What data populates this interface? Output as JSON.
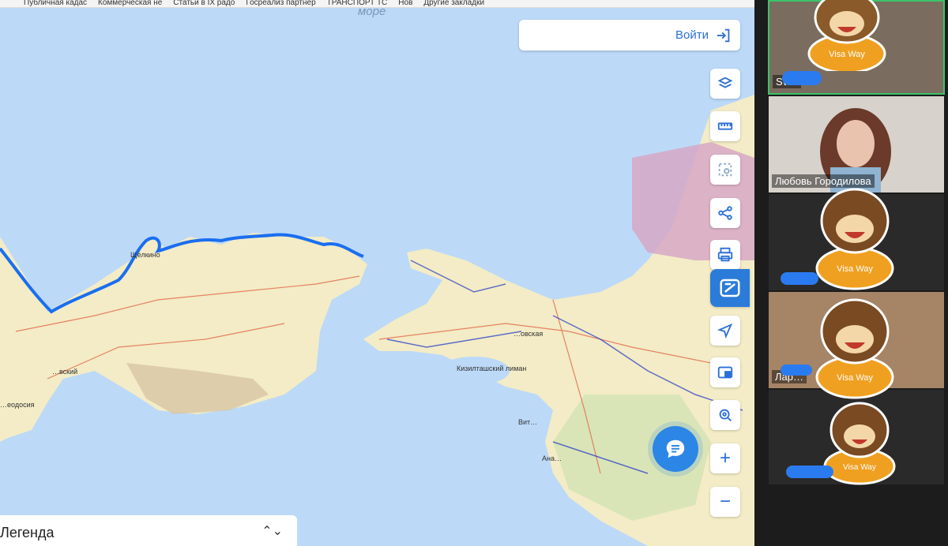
{
  "bookmarks": [
    "Публичная кадас",
    "Коммерческая не",
    "Статьи в IX радо",
    "Госреализ партнёр",
    "ТРАНСПОРТ ТС",
    "Нов",
    "Другие закладки"
  ],
  "map": {
    "sea_label": "море",
    "login_label": "Войти",
    "legend_label": "Легенда",
    "legend_chevron": "⌃⌄",
    "cities": [
      "Щёлкино",
      "…вский",
      "…еодосия",
      "…овская",
      "Кизилташский лиман",
      "Вит…",
      "Ана…"
    ],
    "tools": [
      "layers-icon",
      "ruler-icon",
      "select-area-icon",
      "share-icon",
      "print-icon",
      "panel-icon",
      "navigate-icon",
      "picture-in-picture-icon",
      "location-search-icon",
      "zoom-in-icon",
      "zoom-out-icon"
    ],
    "zoom_in": "+",
    "zoom_out": "−",
    "colors": {
      "sea": "#bcd9f8",
      "land": "#f3ecc6",
      "accent": "#2b7bd9",
      "route": "#1a6ef0"
    }
  },
  "participants": [
    {
      "name": "Sv…",
      "mascot_label": "Visa Way",
      "active": true
    },
    {
      "name": "Любовь Городилова",
      "mascot_label": "",
      "active": false
    },
    {
      "name": "",
      "mascot_label": "Visa Way",
      "active": false
    },
    {
      "name": "Лар…",
      "mascot_label": "Visa Way",
      "active": false
    },
    {
      "name": "",
      "mascot_label": "Visa Way",
      "active": false
    }
  ]
}
